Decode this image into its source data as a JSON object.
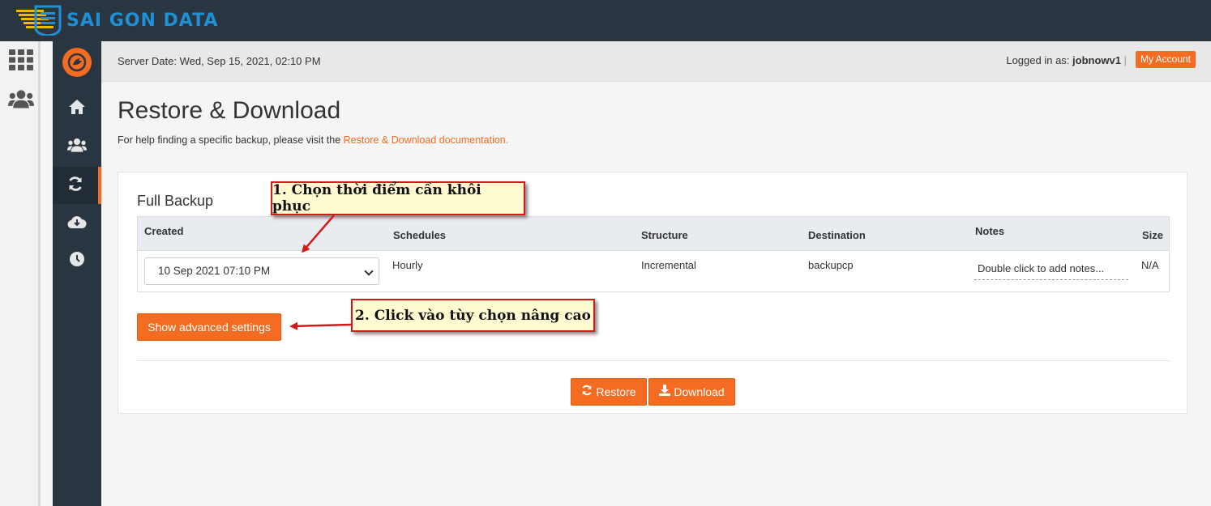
{
  "brand": {
    "name": "SAI GON DATA"
  },
  "rail": {
    "icons": [
      "grid-icon",
      "users-icon"
    ]
  },
  "sidebar": {
    "logo_icon": "jetbackup-logo-icon",
    "items": [
      {
        "name": "home-icon"
      },
      {
        "name": "accounts-icon"
      },
      {
        "name": "restore-icon",
        "active": true
      },
      {
        "name": "cloud-download-icon"
      },
      {
        "name": "clock-icon"
      }
    ]
  },
  "header": {
    "server_date": "Server Date: Wed, Sep 15, 2021, 02:10 PM",
    "logged_label": "Logged in as: ",
    "username": "jobnowv1",
    "separator": "|",
    "my_account": "My Account"
  },
  "page": {
    "title": "Restore & Download",
    "help_text": "For help finding a specific backup, please visit the ",
    "help_link": "Restore & Download documentation."
  },
  "panel": {
    "title": "Full Backup",
    "columns": [
      "Created",
      "Schedules",
      "Structure",
      "Destination",
      "Notes",
      "Size"
    ],
    "row": {
      "created": "10 Sep 2021 07:10 PM",
      "schedules": "Hourly",
      "structure": "Incremental",
      "destination": "backupcp",
      "notes": "Double click to add notes...",
      "size": "N/A"
    },
    "advanced_button": "Show advanced settings",
    "restore_button": "Restore",
    "download_button": "Download"
  },
  "annotations": {
    "step1": "1. Chọn thời điểm cần khôi phục",
    "step2": "2. Click vào tùy chọn nâng cao",
    "color": "#d11a1a"
  },
  "colors": {
    "accent": "#f36c21",
    "dark": "#2a3542",
    "brand": "#1e90d6"
  }
}
